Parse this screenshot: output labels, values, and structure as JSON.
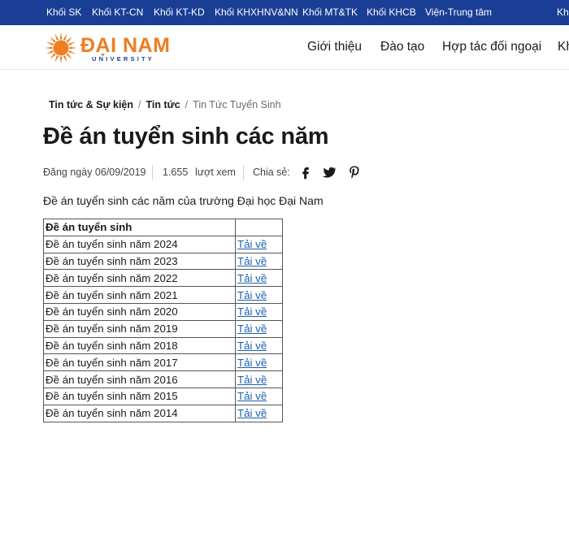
{
  "topbar": {
    "links": [
      "Khối SK",
      "Khối KT-CN",
      "Khối KT-KD",
      "Khối KHXHNV&NN",
      "Khối MT&TK",
      "Khối KHCB",
      "Viện-Trung tâm"
    ],
    "right_partial": "Kh"
  },
  "header": {
    "logo": {
      "title": "ĐẠI NAM",
      "subtitle": "UNIVERSITY",
      "brand_color": "#ef7d22",
      "secondary_color": "#1a3e95"
    },
    "nav": [
      "Giới thiệu",
      "Đào tạo",
      "Hợp tác đối ngoại",
      "Kh"
    ]
  },
  "breadcrumb": {
    "items": [
      "Tin tức & Sự kiện",
      "Tin tức",
      "Tin Tức Tuyển Sinh"
    ],
    "separator": "/"
  },
  "article": {
    "title": "Đề án tuyển sinh các năm",
    "date": "Đăng ngày 06/09/2019",
    "views_count": "1.655",
    "views_label": "lượt xem",
    "share_label": "Chia sẻ:",
    "share_icons": [
      "facebook-icon",
      "twitter-icon",
      "pinterest-icon"
    ],
    "intro": "Đề án tuyển sinh các năm của trường Đại học Đại Nam"
  },
  "table": {
    "header": [
      "Đề án tuyển sinh",
      ""
    ],
    "rows": [
      {
        "name": "Đề án tuyển sinh năm 2024",
        "link": "Tải về"
      },
      {
        "name": "Đề án tuyển sinh năm 2023",
        "link": "Tải về"
      },
      {
        "name": "Đề án tuyển sinh năm 2022",
        "link": "Tải về"
      },
      {
        "name": "Đề án tuyển sinh năm 2021",
        "link": "Tải về"
      },
      {
        "name": "Đề án tuyển sinh năm 2020",
        "link": "Tải về"
      },
      {
        "name": "Đề án tuyển sinh năm 2019",
        "link": "Tải về"
      },
      {
        "name": "Đề án tuyển sinh năm 2018",
        "link": "Tải về"
      },
      {
        "name": "Đề án tuyển sinh năm 2017",
        "link": "Tải về"
      },
      {
        "name": "Đề án tuyển sinh năm 2016",
        "link": "Tải về"
      },
      {
        "name": "Đề án tuyển sinh năm 2015",
        "link": "Tải về"
      },
      {
        "name": "Đề án tuyển sinh năm 2014",
        "link": "Tải về"
      }
    ]
  },
  "colors": {
    "topbar": "#1a3e95",
    "link": "#1a5fb4",
    "text": "#1a1a1a"
  }
}
